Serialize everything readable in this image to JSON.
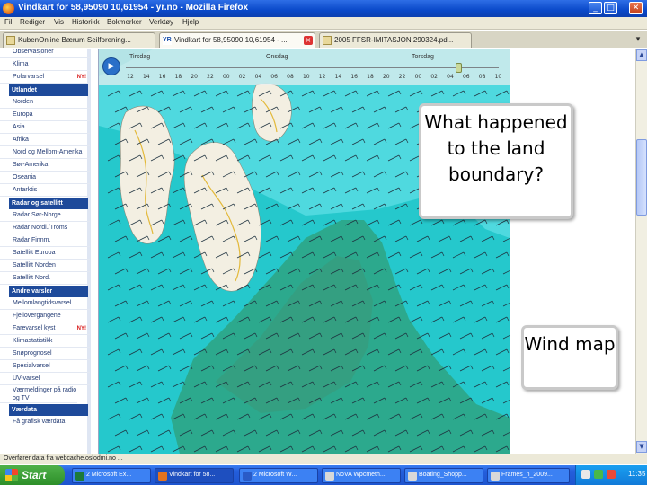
{
  "window": {
    "title": "Vindkart for 58,95090 10,61954 - yr.no - Mozilla Firefox",
    "controls": {
      "minimize": "_",
      "maximize": "□",
      "close": "✕"
    }
  },
  "menu": [
    "Fil",
    "Rediger",
    "Vis",
    "Historikk",
    "Bokmerker",
    "Verktøy",
    "Hjelp"
  ],
  "tabs": [
    {
      "label": "KubenOnline Bærum Seilforening...",
      "icon": "page-icon"
    },
    {
      "label": "Vindkart for 58,95090 10,61954 - ...",
      "icon": "yr-icon",
      "active": true
    },
    {
      "label": "2005 FFSR-IMITASJON 290324.pd...",
      "icon": "page-icon"
    }
  ],
  "sidebar": {
    "items": [
      {
        "type": "item",
        "label": "Observasjoner"
      },
      {
        "type": "item",
        "label": "Klima"
      },
      {
        "type": "item",
        "label": "Polarvarsel",
        "badge": "NY!"
      },
      {
        "type": "head",
        "label": "Utlandet"
      },
      {
        "type": "item",
        "label": "Norden"
      },
      {
        "type": "item",
        "label": "Europa"
      },
      {
        "type": "item",
        "label": "Asia"
      },
      {
        "type": "item",
        "label": "Afrika"
      },
      {
        "type": "item",
        "label": "Nord og Mellom-Amerika"
      },
      {
        "type": "item",
        "label": "Sør-Amerika"
      },
      {
        "type": "item",
        "label": "Oseania"
      },
      {
        "type": "item",
        "label": "Antarktis"
      },
      {
        "type": "head",
        "label": "Radar og satellitt"
      },
      {
        "type": "item",
        "label": "Radar Sør-Norge"
      },
      {
        "type": "item",
        "label": "Radar Nordl./Troms"
      },
      {
        "type": "item",
        "label": "Radar Finnm."
      },
      {
        "type": "item",
        "label": "Satellitt Europa"
      },
      {
        "type": "item",
        "label": "Satellitt Norden"
      },
      {
        "type": "item",
        "label": "Satellitt Nord."
      },
      {
        "type": "head",
        "label": "Andre varsler"
      },
      {
        "type": "item",
        "label": "Mellomlangtidsvarsel"
      },
      {
        "type": "item",
        "label": "Fjellovergangene"
      },
      {
        "type": "item",
        "label": "Farevarsel kyst",
        "badge": "NY!"
      },
      {
        "type": "item",
        "label": "Klimastatistikk"
      },
      {
        "type": "item",
        "label": "Snøprognosel"
      },
      {
        "type": "item",
        "label": "Spesialvarsel"
      },
      {
        "type": "item",
        "label": "UV-varsel"
      },
      {
        "type": "item2",
        "label": "Værmeldinger på radio og TV"
      },
      {
        "type": "head",
        "label": "Værdata"
      },
      {
        "type": "item",
        "label": "Få grafisk værdata"
      }
    ]
  },
  "timeline": {
    "days": [
      "Tirsdag",
      "Onsdag",
      "Torsdag"
    ],
    "hours": [
      "12",
      "14",
      "16",
      "18",
      "20",
      "22",
      "00",
      "02",
      "04",
      "06",
      "08",
      "10",
      "12",
      "14",
      "16",
      "18",
      "20",
      "22",
      "00",
      "02",
      "04",
      "06",
      "08",
      "10"
    ],
    "play_icon": "play-icon"
  },
  "callouts": {
    "top": "What happened to the land boundary?",
    "bottom": "Wind map"
  },
  "status": "Overfører data fra webcache.oslodmi.no ...",
  "taskbar": {
    "start": "Start",
    "tasks": [
      "2 Microsoft Ex...",
      "Vindkart for 58...",
      "2 Microsoft W...",
      "NoVA Wpcmeth...",
      "Boating_Shopp...",
      "Frames_n_2009..."
    ],
    "clock": "11:35"
  },
  "colors": {
    "sea": "#25c8cc",
    "wind_strong": "#4fd9df",
    "wind_weak": "#2f9f78",
    "land": "#f3efe2",
    "titlebar": "#0a49c9",
    "sidebar_head": "#1e4a9a"
  }
}
